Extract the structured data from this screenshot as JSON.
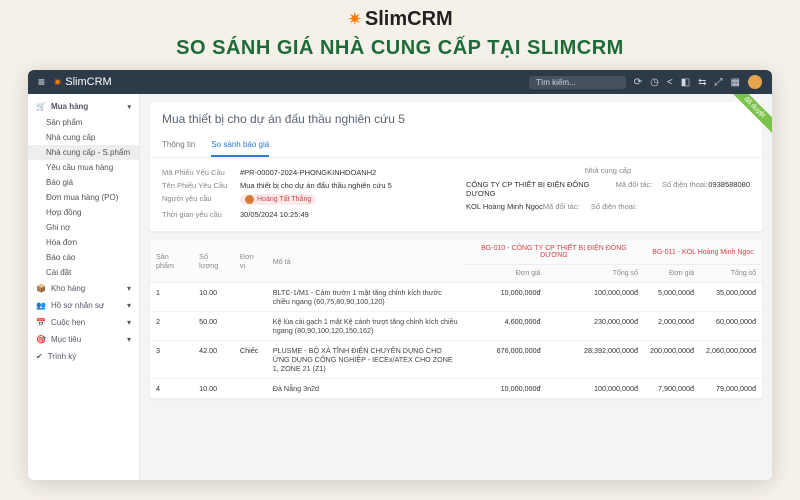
{
  "promo": {
    "brand_name": "SlimCRM",
    "headline": "SO SÁNH GIÁ NHÀ CUNG CẤP TẠI SLIMCRM"
  },
  "topbar": {
    "brand": "SlimCRM",
    "search_placeholder": "Tìm kiếm...",
    "icons": [
      "sync-icon",
      "clock-icon",
      "share-icon",
      "apps-icon",
      "setup-icon",
      "expand-icon",
      "grid-icon"
    ]
  },
  "ribbon": "đã duyệt",
  "sidebar": {
    "mua_hang": {
      "label": "Mua hàng",
      "items": [
        "Sản phẩm",
        "Nhà cung cấp",
        "Nhà cung cấp - S.phẩm",
        "Yêu cầu mua hàng",
        "Báo giá",
        "Đơn mua hàng (PO)",
        "Hợp đồng",
        "Ghi nợ",
        "Hóa đơn",
        "Báo cáo",
        "Cài đặt"
      ]
    },
    "majors": [
      {
        "icon": "📦",
        "label": "Kho hàng"
      },
      {
        "icon": "👥",
        "label": "Hồ sơ nhân sự"
      },
      {
        "icon": "📅",
        "label": "Cuộc hẹn"
      },
      {
        "icon": "🎯",
        "label": "Mục tiêu"
      },
      {
        "icon": "✔",
        "label": "Trình ký"
      }
    ]
  },
  "page": {
    "title": "Mua thiết bị cho dự án đấu thầu nghiên cứu 5",
    "tabs": [
      "Thông tin",
      "So sánh báo giá"
    ],
    "active_tab": 1
  },
  "request": {
    "ma_label": "Mã Phiếu Yêu Cầu",
    "ma": "#PR-00007-2024-PHONGKINHDOANH2",
    "ten_label": "Tên Phiếu Yêu Cầu",
    "ten": "Mua thiết bị cho dự án đấu thầu nghiên cứu 5",
    "nguoi_label": "Người yêu cầu",
    "nguoi": "Hoàng Tất Thắng",
    "thoi_label": "Thời gian yêu cầu",
    "thoi": "30/05/2024 10:25:49"
  },
  "suppliers": {
    "header": "Nhà cung cấp",
    "rows": [
      {
        "name": "CÔNG TY CP THIẾT BỊ ĐIỆN ĐÔNG DƯƠNG",
        "code_label": "Mã đối tác:",
        "code": "",
        "phone_label": "Số điện thoại:",
        "phone": "0938588080"
      },
      {
        "name": "KOL Hoàng Minh Ngọc",
        "code_label": "Mã đối tác:",
        "code": "",
        "phone_label": "Số điện thoại:",
        "phone": ""
      }
    ]
  },
  "table": {
    "cols": {
      "sp": "Sản phẩm",
      "sl": "Số lượng",
      "dv": "Đơn vị",
      "mota": "Mô tả"
    },
    "group1": "BG-010 - CÔNG TY CP THIẾT BỊ ĐIỆN ĐÔNG DƯƠNG",
    "group2": "BG-011 - KOL Hoàng Minh Ngọc",
    "sub": {
      "dongia": "Đơn giá",
      "tongso": "Tổng số"
    },
    "rows": [
      {
        "sp": "1",
        "sl": "10.00",
        "dv": "",
        "mota": "BLTC-1/M1 - Cảm trườn 1 mặt tăng chỉnh kích thước chiều ngang (60,75,80,90,100,120)",
        "g1_dg": "10,000,000đ",
        "g1_ts": "100,000,000đ",
        "g2_dg": "5,000,000đ",
        "g2_ts": "35,000,000đ"
      },
      {
        "sp": "2",
        "sl": "50.00",
        "dv": "",
        "mota": "Kệ lùa cài gạch 1 mặt Kệ cánh trượt tăng chỉnh kích chiều ngang (80,90,100,120,150,162)",
        "g1_dg": "4,600,000đ",
        "g1_ts": "230,000,000đ",
        "g2_dg": "2,000,000đ",
        "g2_ts": "60,000,000đ"
      },
      {
        "sp": "3",
        "sl": "42.00",
        "dv": "Chiếc",
        "mota": "PLUSME - BỘ XẢ TĨNH ĐIỆN CHUYÊN DỤNG CHO ỨNG DỤNG CÔNG NGHIỆP - IECEx/ATEX CHO ZONE 1, ZONE 21 (Z1)",
        "g1_dg": "676,000,000đ",
        "g1_ts": "28,392,000,000đ",
        "g2_dg": "200,000,000đ",
        "g2_ts": "2,060,000,000đ"
      },
      {
        "sp": "4",
        "sl": "10.00",
        "dv": "",
        "mota": "Đà Nẵng 3n2d",
        "g1_dg": "10,000,000đ",
        "g1_ts": "100,000,000đ",
        "g2_dg": "7,900,000đ",
        "g2_ts": "79,000,000đ"
      }
    ]
  }
}
